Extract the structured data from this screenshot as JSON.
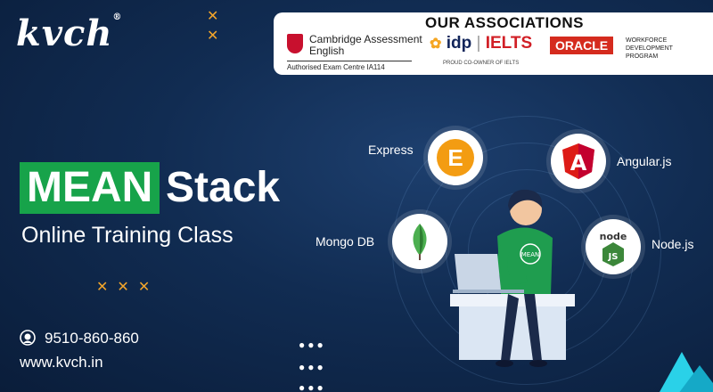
{
  "brand": {
    "logo_text": "kvch",
    "registered": "®"
  },
  "associations": {
    "title": "OUR ASSOCIATIONS",
    "cambridge_name": "Cambridge Assessment English",
    "cambridge_sub": "Authorised Exam Centre  IA114",
    "idp_text": "idp",
    "ielts_text": "IELTS",
    "idp_sub": "PROUD CO-OWNER OF IELTS",
    "oracle_text": "ORACLE",
    "oracle_sub": "WORKFORCE DEVELOPMENT PROGRAM"
  },
  "course": {
    "highlight": "MEAN",
    "title_rest": "Stack",
    "subtitle": "Online Training Class"
  },
  "technologies": [
    {
      "name": "Express",
      "glyph": "E",
      "color": "#f39c12"
    },
    {
      "name": "Angular.js",
      "glyph": "A",
      "color": "#dd1b16"
    },
    {
      "name": "Mongo DB",
      "glyph": "leaf",
      "color": "#4caf50"
    },
    {
      "name": "Node.js",
      "glyph": "node",
      "color": "#3c873a"
    }
  ],
  "person_badge": "MEAN",
  "contact": {
    "phone": "9510-860-860",
    "website": "www.kvch.in"
  },
  "colors": {
    "accent_green": "#17a34a",
    "background": "#112c52",
    "cross_orange": "#f2a52b"
  }
}
